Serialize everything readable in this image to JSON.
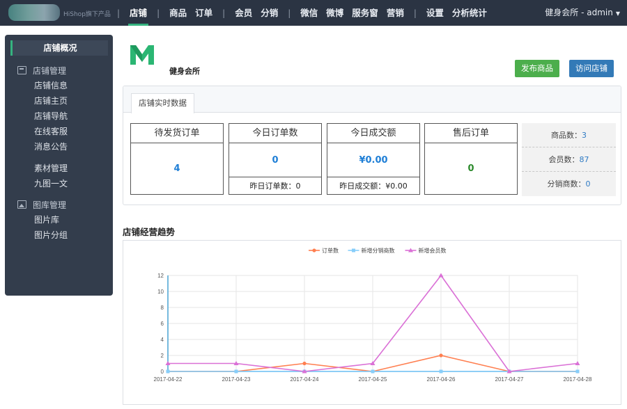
{
  "topbar": {
    "brand_sub": "HiShop旗下产品",
    "nav": [
      "店铺",
      "商品",
      "订单",
      "会员",
      "分销",
      "微信",
      "微博",
      "服务窗",
      "营销",
      "设置",
      "分析统计"
    ],
    "nav_separators_after": [
      0,
      2,
      4,
      8
    ],
    "active_nav": "店铺",
    "user": "健身会所 - admin"
  },
  "sidebar": {
    "head": "店铺概况",
    "group1": {
      "title": "店铺管理",
      "icon": "store-icon",
      "items": [
        "店铺信息",
        "店铺主页",
        "店铺导航",
        "在线客服",
        "消息公告"
      ]
    },
    "group1b": {
      "items": [
        "素材管理",
        "九图一文"
      ]
    },
    "group2": {
      "title": "图库管理",
      "icon": "picture-icon",
      "items": [
        "图片库",
        "图片分组"
      ]
    }
  },
  "header": {
    "store_name": "健身会所",
    "publish_button": "发布商品",
    "visit_button": "访问店铺",
    "brand_color": "#2bb673"
  },
  "realtime": {
    "tab": "店铺实时数据",
    "cards": [
      {
        "title": "待发货订单",
        "value": "4",
        "color": "blue"
      },
      {
        "title": "今日订单数",
        "value": "0",
        "color": "blue",
        "foot": "昨日订单数：0"
      },
      {
        "title": "今日成交额",
        "value": "¥0.00",
        "color": "blue",
        "foot": "昨日成交额：¥0.00"
      },
      {
        "title": "售后订单",
        "value": "0",
        "color": "green"
      }
    ],
    "side": [
      {
        "label": "商品数：",
        "value": "3"
      },
      {
        "label": "会员数：",
        "value": "87"
      },
      {
        "label": "分销商数：",
        "value": "0"
      }
    ]
  },
  "trend": {
    "title": "店铺经营趋势"
  },
  "chart_data": {
    "type": "line",
    "categories": [
      "2017-04-22",
      "2017-04-23",
      "2017-04-24",
      "2017-04-25",
      "2017-04-26",
      "2017-04-27",
      "2017-04-28"
    ],
    "ylim": [
      0,
      12
    ],
    "yticks": [
      0,
      2,
      4,
      6,
      8,
      10,
      12
    ],
    "grid": true,
    "legend_position": "top-center",
    "series": [
      {
        "name": "订单数",
        "values": [
          0,
          0,
          1,
          0,
          2,
          0,
          0
        ],
        "color": "#ff7f50",
        "marker": "circle"
      },
      {
        "name": "新增分销商数",
        "values": [
          0,
          0,
          0,
          0,
          0,
          0,
          0
        ],
        "color": "#87cefa",
        "marker": "square"
      },
      {
        "name": "新增会员数",
        "values": [
          1,
          1,
          0,
          1,
          12,
          0,
          1
        ],
        "color": "#da70d6",
        "marker": "triangle"
      }
    ]
  }
}
